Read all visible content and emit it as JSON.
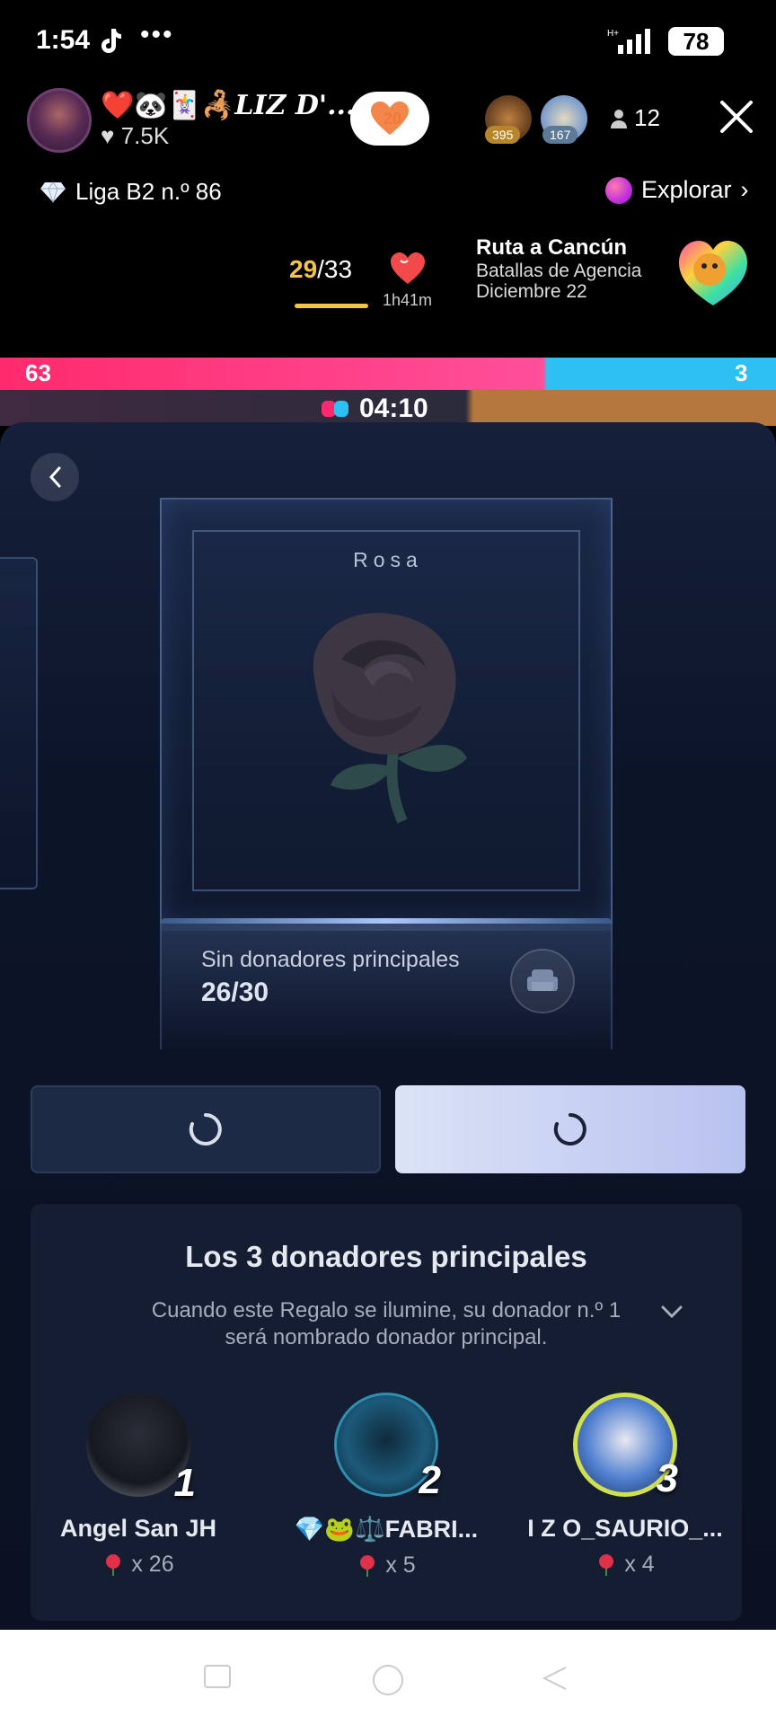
{
  "status_bar": {
    "time": "1:54",
    "dots": "•••",
    "battery": "78"
  },
  "live": {
    "host_name": "LIZ D'...",
    "host_emojis": "❤️🐼🃏🦂",
    "likes": "7.5K",
    "fan_level": "20",
    "viewer_badges": [
      "395",
      "167"
    ],
    "viewer_count": "12",
    "league": "Liga B2 n.º 86",
    "explore_label": "Explorar",
    "progress_done": "29",
    "progress_total": "/33",
    "timer": "1h41m",
    "event_title": "Ruta a Cancún",
    "event_line1": "Batallas de Agencia",
    "event_line2": "Diciembre 22"
  },
  "battle": {
    "score_left": "63",
    "score_right": "3",
    "timer": "04:10"
  },
  "gift": {
    "name": "Rosa",
    "no_donors": "Sin donadores principales",
    "progress": "26/30"
  },
  "donors": {
    "title": "Los 3 donadores principales",
    "description": "Cuando este Regalo se ilumine, su donador n.º 1 será nombrado donador principal.",
    "list": [
      {
        "rank": "1",
        "name": "Angel San JH",
        "count": "x 26"
      },
      {
        "rank": "2",
        "name": "💎🐸⚖️FABRI...",
        "count": "x 5"
      },
      {
        "rank": "3",
        "name": "I Z O_SAURIO_...",
        "count": "x 4"
      }
    ]
  },
  "colors": {
    "accent_pink": "#ff2a6d",
    "accent_blue": "#2cc0f3",
    "gold": "#f5c542",
    "sheet_bg": "#0c1428"
  }
}
